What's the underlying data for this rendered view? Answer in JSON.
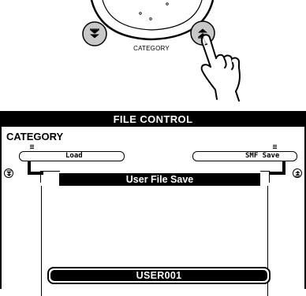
{
  "illustration": {
    "category_caption": "CATEGORY"
  },
  "panel": {
    "title": "FILE CONTROL",
    "category_label": "CATEGORY",
    "left_item": "Load",
    "right_item": "SMF Save",
    "dialog_title": "User File Save",
    "filename": "USER001"
  },
  "icons": {
    "category_down_button": "double-chevron-down-icon",
    "category_up_button": "double-chevron-up-icon",
    "pointing_hand": "pointing-hand-icon",
    "scroll_left": "double-chevron-down-icon",
    "scroll_right": "double-chevron-up-icon"
  },
  "colors": {
    "lcd_fill": "#000000",
    "button_fill": "#c8c8c8",
    "background": "#ffffff"
  }
}
